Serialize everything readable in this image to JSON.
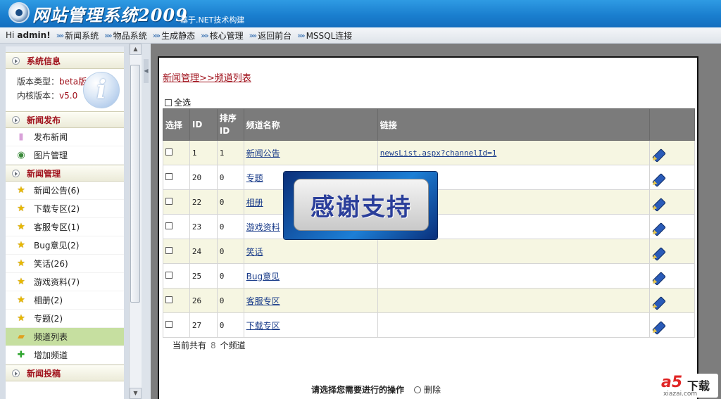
{
  "header": {
    "title": "网站管理系统2009",
    "subtitle": "基于.NET技术构建"
  },
  "navbar": {
    "greeting": "Hi",
    "username": "admin!",
    "items": [
      "新闻系统",
      "物品系统",
      "生成静态",
      "核心管理",
      "返回前台",
      "MSSQL连接"
    ]
  },
  "sidebar": {
    "sections": [
      {
        "title": "系统信息",
        "info": [
          {
            "label": "版本类型：",
            "value": "beta版"
          },
          {
            "label": "内核版本：",
            "value": "v5.0"
          }
        ]
      },
      {
        "title": "新闻发布",
        "items": [
          {
            "label": "发布新闻",
            "icon": "document-icon"
          },
          {
            "label": "图片管理",
            "icon": "picture-icon"
          }
        ]
      },
      {
        "title": "新闻管理",
        "items": [
          {
            "label": "新闻公告(6)"
          },
          {
            "label": "下载专区(2)"
          },
          {
            "label": "客服专区(1)"
          },
          {
            "label": "Bug意见(2)"
          },
          {
            "label": "笑话(26)"
          },
          {
            "label": "游戏资料(7)"
          },
          {
            "label": "相册(2)"
          },
          {
            "label": "专题(2)"
          },
          {
            "label": "频道列表"
          },
          {
            "label": "增加频道"
          }
        ]
      },
      {
        "title": "新闻投稿"
      }
    ]
  },
  "main": {
    "breadcrumb": "新闻管理>>频道列表",
    "select_all": "全选",
    "columns": [
      "选择",
      "ID",
      "排序ID",
      "频道名称",
      "链接"
    ],
    "rows": [
      {
        "id": "1",
        "sort": "1",
        "name": "新闻公告",
        "link": "newsList.aspx?channelId=1"
      },
      {
        "id": "20",
        "sort": "0",
        "name": "专题",
        "link": ""
      },
      {
        "id": "22",
        "sort": "0",
        "name": "相册",
        "link": ""
      },
      {
        "id": "23",
        "sort": "0",
        "name": "游戏资料",
        "link": ""
      },
      {
        "id": "24",
        "sort": "0",
        "name": "笑话",
        "link": ""
      },
      {
        "id": "25",
        "sort": "0",
        "name": "Bug意见",
        "link": ""
      },
      {
        "id": "26",
        "sort": "0",
        "name": "客服专区",
        "link": ""
      },
      {
        "id": "27",
        "sort": "0",
        "name": "下载专区",
        "link": ""
      }
    ],
    "count_prefix": "当前共有",
    "count_value": "8",
    "count_suffix": "个频道",
    "ops_label": "请选择您需要进行的操作",
    "ops_delete": "删除"
  },
  "overlay": {
    "thanks": "感谢支持"
  },
  "watermark": {
    "brand": "a5",
    "text": "下载",
    "site": "xiazai.com"
  }
}
